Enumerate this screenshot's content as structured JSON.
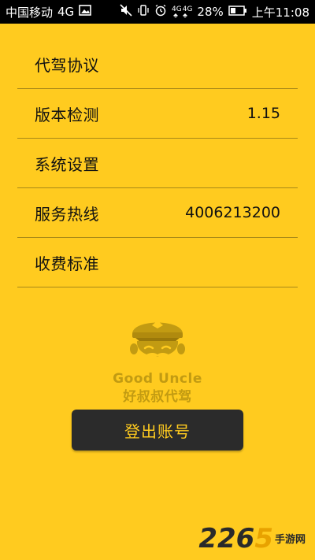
{
  "status_bar": {
    "carrier": "中国移动",
    "network": "4G",
    "network_small_1": "4G",
    "network_small_2": "4G",
    "battery": "28%",
    "time": "上午11:08"
  },
  "settings": {
    "items": [
      {
        "label": "代驾协议",
        "value": ""
      },
      {
        "label": "版本检测",
        "value": "1.15"
      },
      {
        "label": "系统设置",
        "value": ""
      },
      {
        "label": "服务热线",
        "value": "4006213200"
      },
      {
        "label": "收费标准",
        "value": ""
      }
    ]
  },
  "logo": {
    "english": "Good Uncle",
    "chinese": "好叔叔代驾"
  },
  "logout_button": {
    "label": "登出账号"
  },
  "watermark": {
    "number_main": "226",
    "number_accent": "5",
    "text": "手游网"
  },
  "colors": {
    "background": "#FFCB1F",
    "button_bg": "#2B2B2B",
    "button_text": "#FFCB1F",
    "logo": "#C29B12",
    "divider": "#A88818"
  }
}
